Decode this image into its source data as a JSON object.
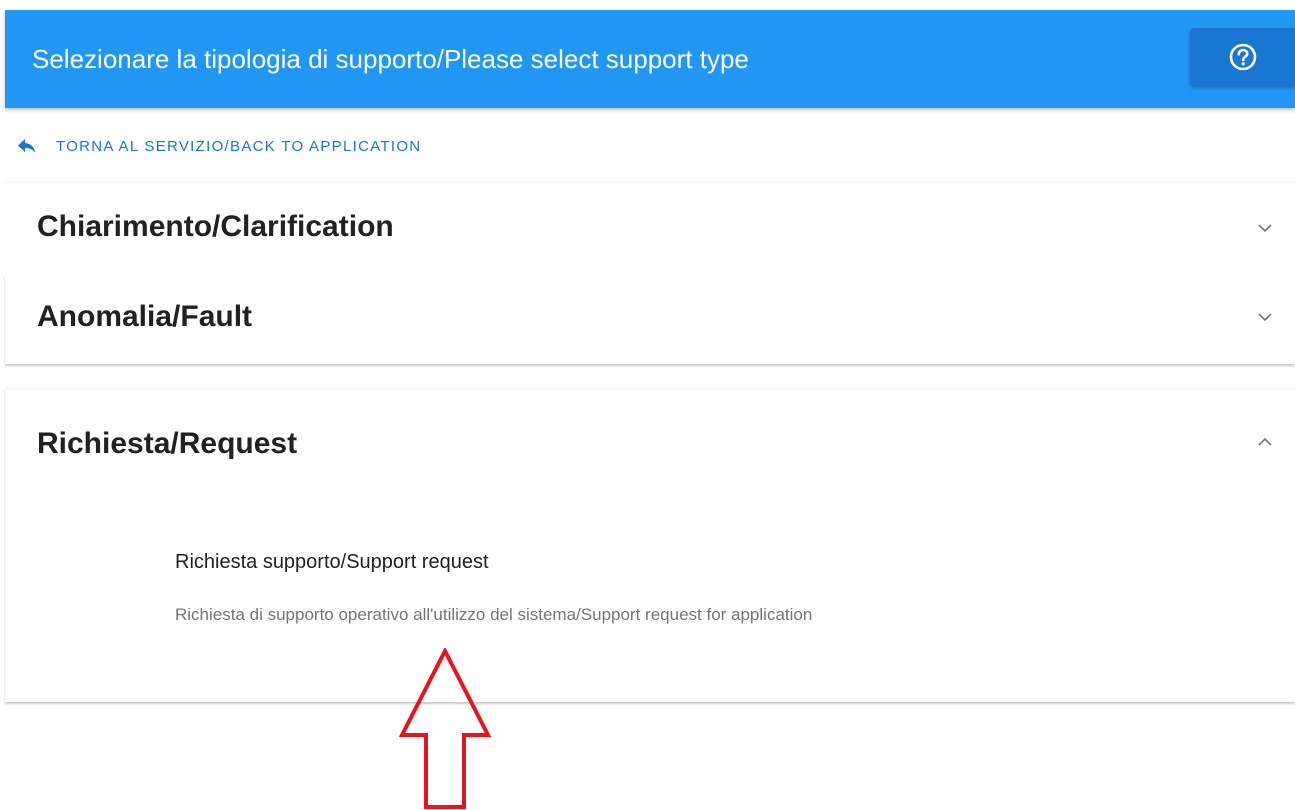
{
  "header": {
    "title": "Selezionare la tipologia di supporto/Please select support type",
    "help_icon": "help-circle-icon",
    "background": "#2196f3",
    "button_background": "#1976d2"
  },
  "back_link": {
    "label": "TORNA AL SERVIZIO/BACK TO APPLICATION",
    "icon": "reply-arrow-icon",
    "color": "#1976d2"
  },
  "sections": [
    {
      "title": "Chiarimento/Clarification",
      "expanded": false,
      "icon": "chevron-down-icon"
    },
    {
      "title": "Anomalia/Fault",
      "expanded": false,
      "icon": "chevron-down-icon"
    },
    {
      "title": "Richiesta/Request",
      "expanded": true,
      "icon": "chevron-up-icon",
      "options": [
        {
          "title": "Richiesta supporto/Support request",
          "description": "Richiesta di supporto operativo all'utilizzo del sistema/Support request for application"
        }
      ]
    }
  ],
  "annotation": {
    "icon": "up-arrow-outline-icon",
    "color": "#e8141c"
  }
}
